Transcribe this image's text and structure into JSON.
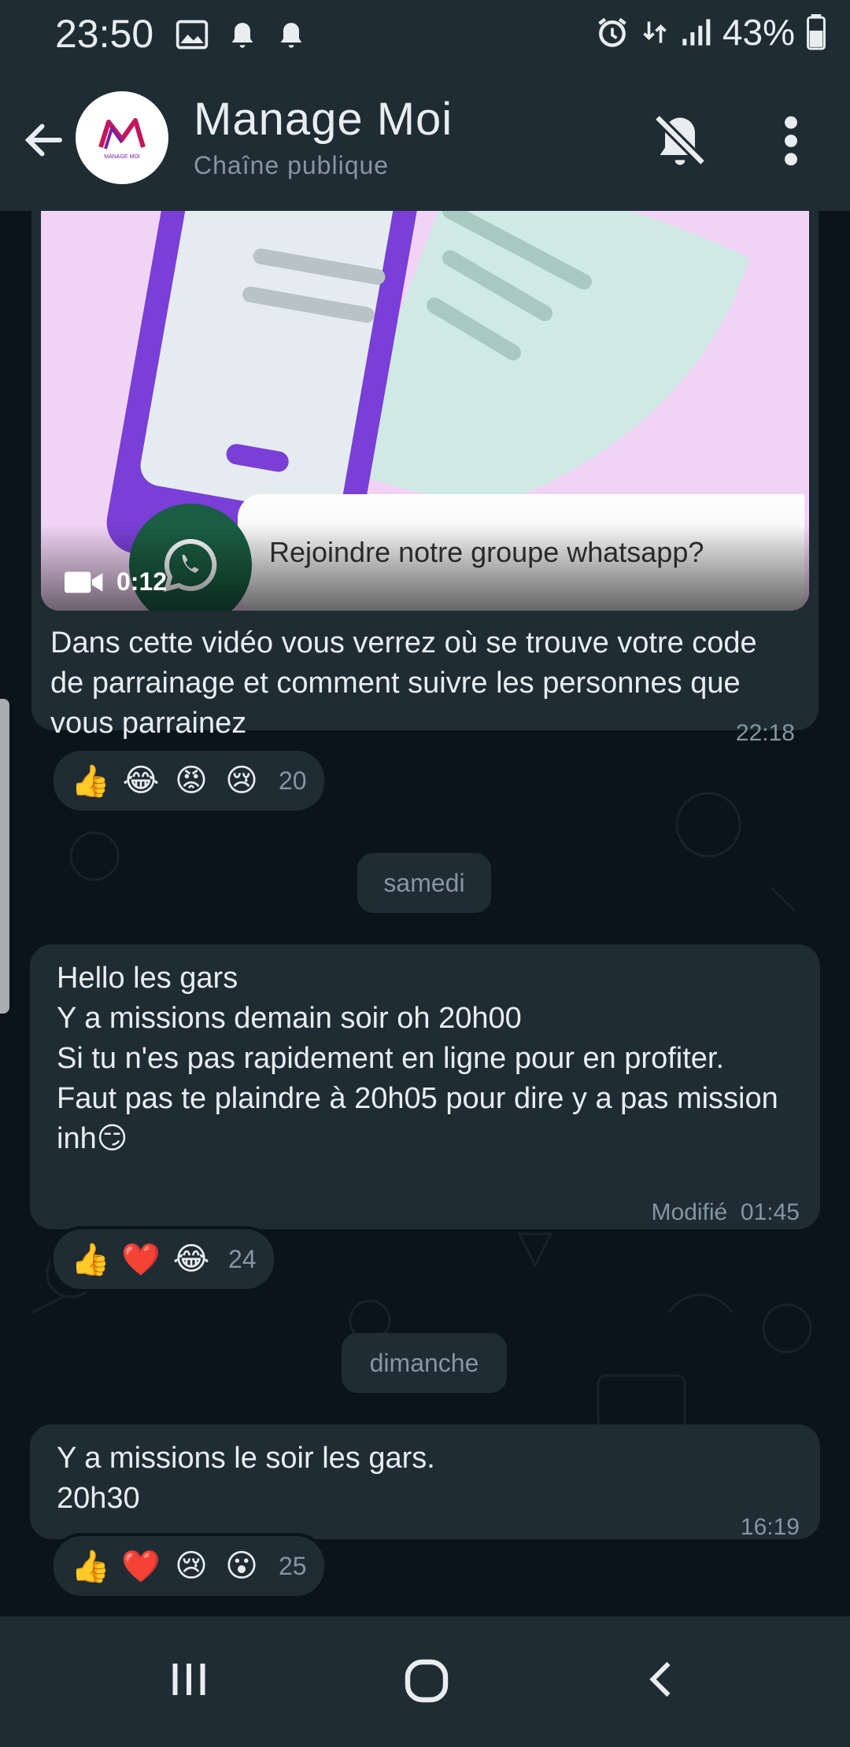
{
  "status": {
    "time": "23:50",
    "battery": "43%",
    "left_icons": [
      "gallery-icon",
      "bell-icon",
      "bell-icon"
    ],
    "right_icons": [
      "alarm-icon",
      "data-transfer-icon",
      "signal-icon",
      "battery-icon"
    ]
  },
  "header": {
    "title": "Manage Moi",
    "subtitle": "Chaîne publique",
    "avatar_text": "MANAGE MOI"
  },
  "messages": [
    {
      "video": {
        "duration": "0:12",
        "caption": "Rejoindre notre groupe whatsapp?"
      },
      "text": "Dans cette vidéo vous verrez où se trouve votre code de parrainage et comment suivre les personnes que vous parrainez",
      "time": "22:18",
      "reactions": [
        "👍",
        "😂",
        "😡",
        "😢"
      ],
      "reaction_count": "20"
    },
    {
      "day": "samedi",
      "text": "Hello les gars\nY a missions demain soir oh 20h00\nSi tu n'es pas rapidement en ligne pour en profiter.\nFaut pas te plaindre à 20h05 pour dire y a pas mission inh😏",
      "edited": "Modifié",
      "time": "01:45",
      "reactions": [
        "👍",
        "❤️",
        "😂"
      ],
      "reaction_count": "24"
    },
    {
      "day": "dimanche",
      "text": "Y a missions le soir les gars.\n20h30",
      "time": "16:19",
      "reactions": [
        "👍",
        "❤️",
        "😢",
        "😮"
      ],
      "reaction_count": "25"
    }
  ],
  "colors": {
    "header_bg": "#1f2c34",
    "chat_bg": "#0b141a",
    "bubble_bg": "#1f2c34",
    "text_primary": "#e9edef",
    "text_secondary": "#8696a0"
  }
}
